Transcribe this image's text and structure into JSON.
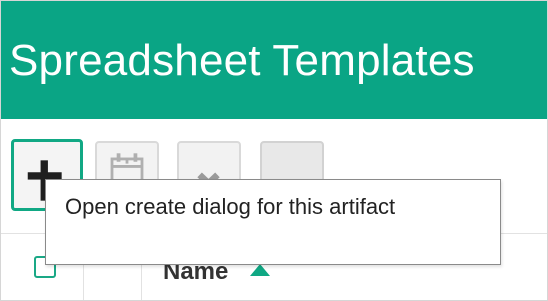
{
  "header": {
    "title": "Spreadsheet Templates",
    "background_color": "#0aa585"
  },
  "toolbar": {
    "buttons": [
      {
        "name": "create",
        "icon": "plus-icon",
        "state": "focused"
      },
      {
        "name": "calendar",
        "icon": "calendar-icon",
        "state": "disabled"
      },
      {
        "name": "delete",
        "icon": "close-icon",
        "state": "disabled"
      },
      {
        "name": "more",
        "icon": "ellipsis-icon",
        "state": "enabled"
      }
    ]
  },
  "tooltip": {
    "text": "Open create dialog for this artifact"
  },
  "grid": {
    "columns": [
      {
        "label": "Name",
        "sort": "ascending"
      }
    ]
  },
  "colors": {
    "accent": "#0aa585",
    "checkbox_border": "#1aa886",
    "sort_arrow": "#10a884"
  }
}
